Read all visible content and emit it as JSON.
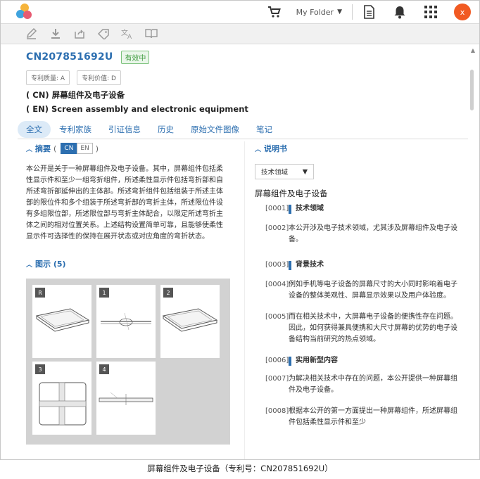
{
  "topbar": {
    "folder_label": "My Folder",
    "avatar_letter": "x",
    "icons": [
      "cart-icon",
      "document-icon",
      "bell-icon",
      "apps-grid-icon"
    ]
  },
  "toolbar": {
    "icons": [
      "pen-icon",
      "download-icon",
      "share-icon",
      "tag-icon",
      "translate-icon",
      "book-icon"
    ]
  },
  "patent": {
    "number": "CN207851692U",
    "status": "有效中",
    "quality": "专利质量: A",
    "value": "专利价值: D",
    "title_cn": "( CN) 屏幕组件及电子设备",
    "title_en": "( EN) Screen assembly and electronic equipment"
  },
  "tabs": [
    {
      "label": "全文",
      "active": true
    },
    {
      "label": "专利家族"
    },
    {
      "label": "引证信息"
    },
    {
      "label": "历史"
    },
    {
      "label": "原始文件图像"
    },
    {
      "label": "笔记"
    }
  ],
  "abstract": {
    "heading": "摘要",
    "lang_cn": "CN",
    "lang_en": "EN",
    "text": "本公开是关于一种屏幕组件及电子设备。其中，屏幕组件包括柔性显示件和至少一组弯折组件，所述柔性显示件包括弯折部和自所述弯折部延伸出的主体部。所述弯折组件包括组装于所述主体部的限位件和多个组装于所述弯折部的弯折主体，所述限位件设有多组限位部，所述限位部与弯折主体配合，以限定所述弯折主体之间的相对位置关系。上述结构设置简单可靠，且能够使柔性显示件可选择性的保持在展开状态或对应角度的弯折状态。"
  },
  "figures": {
    "heading": "图示 (5)",
    "labels": [
      "R",
      "1",
      "2",
      "3",
      "4"
    ]
  },
  "spec": {
    "heading": "说明书",
    "dropdown": "技术领域",
    "title": "屏幕组件及电子设备",
    "paragraphs": [
      {
        "num": "[0001]",
        "text": "技术领域",
        "head": true
      },
      {
        "num": "[0002]",
        "text": "本公开涉及电子技术领域，尤其涉及屏幕组件及电子设备。"
      },
      {
        "num": "[0003]",
        "text": "背景技术",
        "head": true
      },
      {
        "num": "[0004]",
        "text": "例如手机等电子设备的屏幕尺寸的大小同时影响着电子设备的整体美观性、屏幕显示效果以及用户体验度。"
      },
      {
        "num": "[0005]",
        "text": "而在相关技术中，大屏幕电子设备的便携性存在问题。因此，如何获得兼具便携和大尺寸屏幕的优势的电子设备结构当前研究的热点领域。"
      },
      {
        "num": "[0006]",
        "text": "实用新型内容",
        "head": true
      },
      {
        "num": "[0007]",
        "text": "为解决相关技术中存在的问题，本公开提供一种屏幕组件及电子设备。"
      },
      {
        "num": "[0008]",
        "text": "根据本公开的第一方面提出一种屏幕组件，所述屏幕组件包括柔性显示件和至少"
      }
    ]
  },
  "caption": "屏幕组件及电子设备（专利号：CN207851692U）"
}
